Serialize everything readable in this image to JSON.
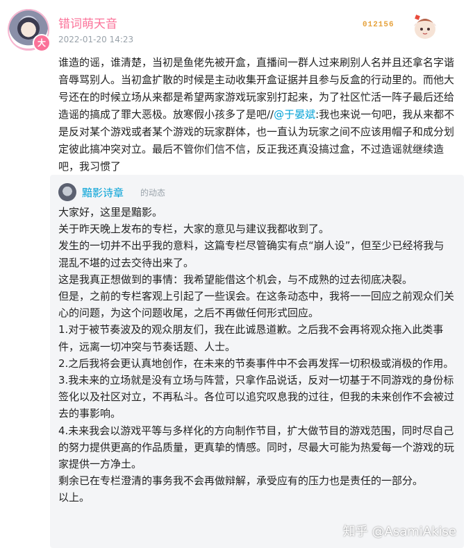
{
  "post": {
    "avatar_badge": "大",
    "username": "错词萌天音",
    "timestamp": "2022-01-20 14:23",
    "fan_badge_number": "012156",
    "text_before_mention": "谁造的谣，谁清楚，当初是鱼佬先被开盒，直播间一群人过来刷别人名并且还拿名字谐音辱骂别人。当初盒扩散的时候是主动收集开盒证据并且参与反盒的行动里的。而他大号还在的时候立场从来都是希望两家游戏玩家别打起来，为了社区忙活一阵子最后还给造谣的搞成了罪大恶极。放寒假小孩多了是吧//",
    "mention": "@于晏斌",
    "text_after_mention": ":我也来说一句吧，我从来都不是反对某个游戏或者某个游戏的玩家群体，也一直认为玩家之间不应该用帽子和成分划定彼此搞冲突对立。最后不管你们信不信，反正我还真没搞过盒，不过造谣就继续造吧，我习惯了"
  },
  "repost": {
    "author": "黯影诗章",
    "type_label": "的动态",
    "paragraphs": [
      "大家好，这里是黯影。",
      "关于昨天晚上发布的专栏，大家的意见与建议我都收到了。",
      "发生的一切并不出乎我的意料，这篇专栏尽管确实有点“崩人设”，但至少已经将我与混乱不堪的过去交待出来了。",
      "这是我真正想做到的事情：我希望能借这个机会，与不成熟的过去彻底决裂。",
      "但是，之前的专栏客观上引起了一些误会。在这条动态中，我将一一回应之前观众们关心的问题，为这个问题收尾，之后不再做任何形式回应。",
      "1.对于被节奏波及的观众朋友们，我在此诚恳道歉。之后我不会再将观众拖入此类事件，远离一切冲突与节奏话题、人士。",
      "2.之后我将会更认真地创作，在未来的节奏事件中不会再发挥一切积极或消极的作用。",
      "3.我未来的立场就是没有立场与阵营，只拿作品说话，反对一切基于不同游戏的身份标签化以及社区对立，不再私斗。各位可以追究叹息我的过往，但我的未来创作不会被过去的事影响。",
      "4.未来我会以游戏平等与多样化的方向制作节目，扩大做节目的游戏范围，同时尽自己的努力提供更高的作品质量，更真挚的情感。同时，尽最大可能为热爱每一个游戏的玩家提供一方净土。",
      "剩余已在专栏澄清的事务我不会再做辩解，承受应有的压力也是责任的一部分。",
      "以上。"
    ]
  },
  "watermark": "知乎 @AsamiAkise",
  "colors": {
    "username": "#fb7299",
    "mention": "#00a1d6",
    "repost_author": "#00a1d6",
    "repost_bg": "#f4f5f7",
    "meta": "#99a2aa",
    "fan_badge": "#e6a23c"
  }
}
